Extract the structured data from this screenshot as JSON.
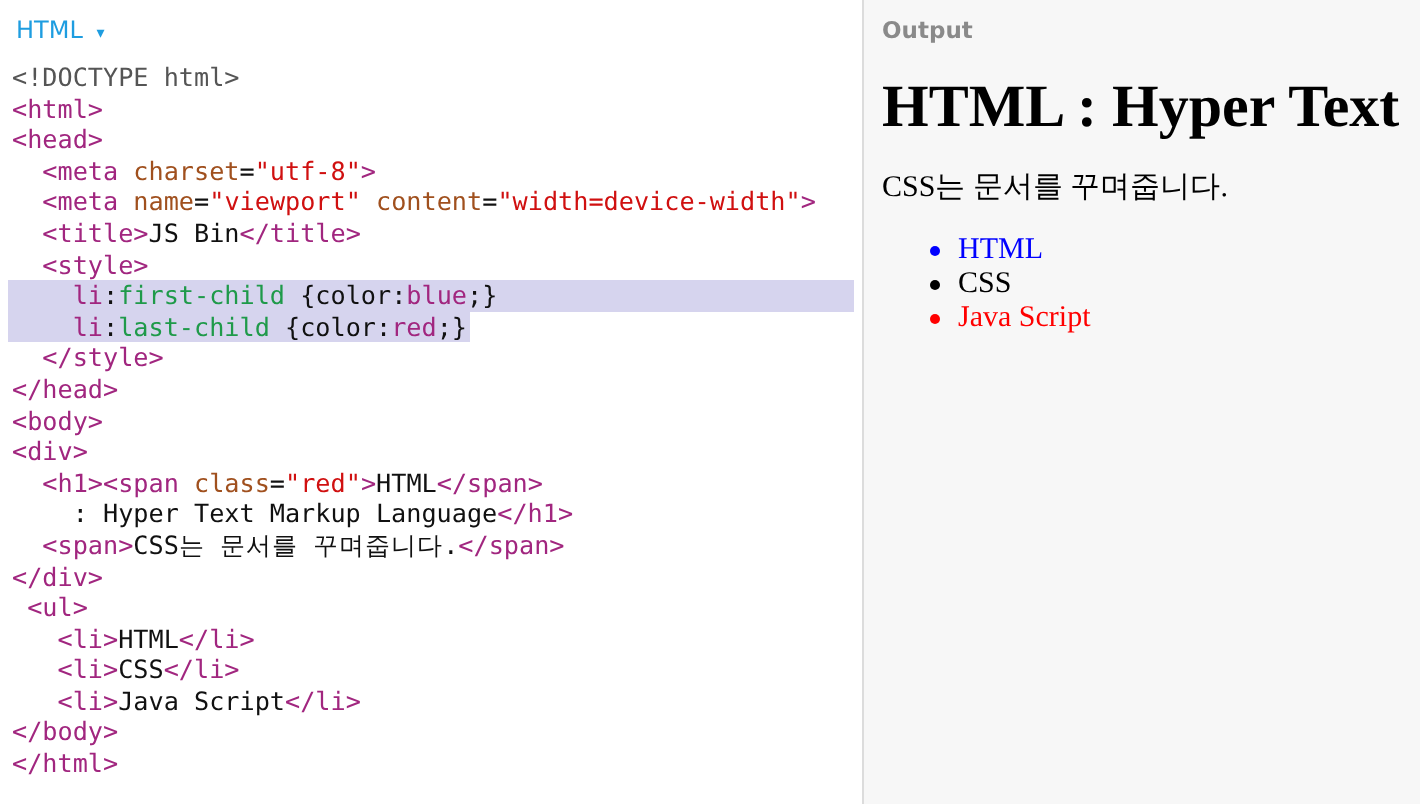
{
  "editor": {
    "language": "HTML",
    "dropdown": "▾",
    "lines": [
      {
        "selected": false,
        "tokens": [
          {
            "kind": "doctype",
            "text": "<!DOCTYPE html>"
          }
        ]
      },
      {
        "selected": false,
        "tokens": [
          {
            "kind": "tag",
            "text": "<html>"
          }
        ]
      },
      {
        "selected": false,
        "tokens": [
          {
            "kind": "tag",
            "text": "<head>"
          }
        ]
      },
      {
        "selected": false,
        "tokens": [
          {
            "kind": "tag",
            "text": "  <meta "
          },
          {
            "kind": "attr",
            "text": "charset"
          },
          {
            "kind": "text",
            "text": "="
          },
          {
            "kind": "string",
            "text": "\"utf-8\""
          },
          {
            "kind": "tag",
            "text": ">"
          }
        ]
      },
      {
        "selected": false,
        "tokens": [
          {
            "kind": "tag",
            "text": "  <meta "
          },
          {
            "kind": "attr",
            "text": "name"
          },
          {
            "kind": "text",
            "text": "="
          },
          {
            "kind": "string",
            "text": "\"viewport\""
          },
          {
            "kind": "attr",
            "text": " content"
          },
          {
            "kind": "text",
            "text": "="
          },
          {
            "kind": "string",
            "text": "\"width=device-width\""
          },
          {
            "kind": "tag",
            "text": ">"
          }
        ]
      },
      {
        "selected": false,
        "tokens": [
          {
            "kind": "tag",
            "text": "  <title>"
          },
          {
            "kind": "text",
            "text": "JS Bin"
          },
          {
            "kind": "tag",
            "text": "</title>"
          }
        ]
      },
      {
        "selected": false,
        "tokens": [
          {
            "kind": "tag",
            "text": "  <style>"
          }
        ]
      },
      {
        "selected": true,
        "tokens": [
          {
            "kind": "tag",
            "text": "    li"
          },
          {
            "kind": "text",
            "text": ":"
          },
          {
            "kind": "property",
            "text": "first-child"
          },
          {
            "kind": "text",
            "text": " {color:"
          },
          {
            "kind": "tag",
            "text": "blue"
          },
          {
            "kind": "text",
            "text": ";}"
          }
        ]
      },
      {
        "selected": true,
        "tokens": [
          {
            "kind": "tag",
            "text": "    li"
          },
          {
            "kind": "text",
            "text": ":"
          },
          {
            "kind": "property",
            "text": "last-child"
          },
          {
            "kind": "text",
            "text": " {color:"
          },
          {
            "kind": "tag",
            "text": "red"
          },
          {
            "kind": "text",
            "text": ";}"
          }
        ]
      },
      {
        "selected": false,
        "tokens": [
          {
            "kind": "tag",
            "text": "  </style>"
          }
        ]
      },
      {
        "selected": false,
        "tokens": [
          {
            "kind": "tag",
            "text": "</head>"
          }
        ]
      },
      {
        "selected": false,
        "tokens": [
          {
            "kind": "tag",
            "text": "<body>"
          }
        ]
      },
      {
        "selected": false,
        "tokens": [
          {
            "kind": "tag",
            "text": "<div>"
          }
        ]
      },
      {
        "selected": false,
        "tokens": [
          {
            "kind": "tag",
            "text": "  <h1><span "
          },
          {
            "kind": "attr",
            "text": "class"
          },
          {
            "kind": "text",
            "text": "="
          },
          {
            "kind": "string",
            "text": "\"red\""
          },
          {
            "kind": "tag",
            "text": ">"
          },
          {
            "kind": "text",
            "text": "HTML"
          },
          {
            "kind": "tag",
            "text": "</span>"
          }
        ]
      },
      {
        "selected": false,
        "tokens": [
          {
            "kind": "text",
            "text": "    : Hyper Text Markup Language"
          },
          {
            "kind": "tag",
            "text": "</h1>"
          }
        ]
      },
      {
        "selected": false,
        "tokens": [
          {
            "kind": "tag",
            "text": "  <span>"
          },
          {
            "kind": "text",
            "text": "CSS는 문서를 꾸며줍니다."
          },
          {
            "kind": "tag",
            "text": "</span>"
          }
        ]
      },
      {
        "selected": false,
        "tokens": [
          {
            "kind": "tag",
            "text": "</div>"
          }
        ]
      },
      {
        "selected": false,
        "tokens": [
          {
            "kind": "tag",
            "text": " <ul>"
          }
        ]
      },
      {
        "selected": false,
        "tokens": [
          {
            "kind": "tag",
            "text": "   <li>"
          },
          {
            "kind": "text",
            "text": "HTML"
          },
          {
            "kind": "tag",
            "text": "</li>"
          }
        ]
      },
      {
        "selected": false,
        "tokens": [
          {
            "kind": "tag",
            "text": "   <li>"
          },
          {
            "kind": "text",
            "text": "CSS"
          },
          {
            "kind": "tag",
            "text": "</li>"
          }
        ]
      },
      {
        "selected": false,
        "tokens": [
          {
            "kind": "tag",
            "text": "   <li>"
          },
          {
            "kind": "text",
            "text": "Java Script"
          },
          {
            "kind": "tag",
            "text": "</li>"
          }
        ]
      },
      {
        "selected": false,
        "tokens": [
          {
            "kind": "tag",
            "text": "</body>"
          }
        ]
      },
      {
        "selected": false,
        "tokens": [
          {
            "kind": "tag",
            "text": "</html>"
          }
        ]
      }
    ]
  },
  "output": {
    "label": "Output",
    "heading": "HTML : Hyper Text",
    "paragraph": "CSS는 문서를 꾸며줍니다.",
    "items": [
      {
        "text": "HTML",
        "color": "#0000ff"
      },
      {
        "text": "CSS",
        "color": "#000000"
      },
      {
        "text": "Java Script",
        "color": "#ff0000"
      }
    ]
  }
}
